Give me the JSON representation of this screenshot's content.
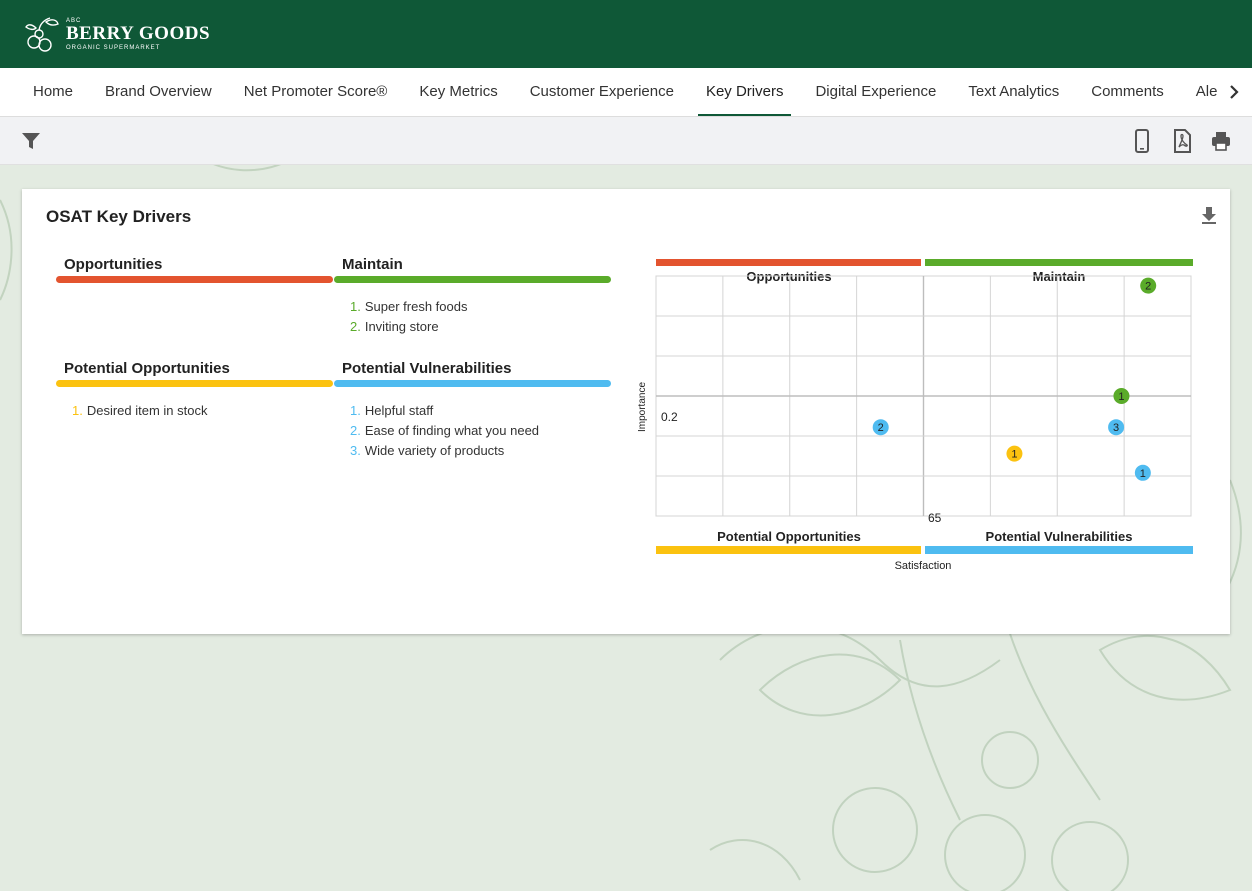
{
  "brand": {
    "abc": "ABC",
    "name": "BERRY GOODS",
    "subtitle": "ORGANIC SUPERMARKET"
  },
  "nav": {
    "tabs": [
      {
        "label": "Home",
        "active": false
      },
      {
        "label": "Brand Overview",
        "active": false
      },
      {
        "label": "Net Promoter Score®",
        "active": false
      },
      {
        "label": "Key Metrics",
        "active": false
      },
      {
        "label": "Customer Experience",
        "active": false
      },
      {
        "label": "Key Drivers",
        "active": true
      },
      {
        "label": "Digital Experience",
        "active": false
      },
      {
        "label": "Text Analytics",
        "active": false
      },
      {
        "label": "Comments",
        "active": false
      },
      {
        "label": "Alerts",
        "active": false
      }
    ],
    "scroll_icon": "chevron-right-icon"
  },
  "toolbar": {
    "left_icons": [
      "filter-icon"
    ],
    "right_icons": [
      "mobile-icon",
      "pdf-icon",
      "print-icon"
    ]
  },
  "card": {
    "title": "OSAT Key Drivers",
    "download_icon": "download-icon"
  },
  "colors": {
    "opportunities": "#e3542f",
    "maintain": "#5aab2a",
    "potential_opportunities": "#fbc210",
    "potential_vulnerabilities": "#4fbbf0",
    "header_green": "#0f5837"
  },
  "quadrants": {
    "opportunities": {
      "title": "Opportunities",
      "items": []
    },
    "maintain": {
      "title": "Maintain",
      "items": [
        "Super fresh foods",
        "Inviting store"
      ]
    },
    "potential_opportunities": {
      "title": "Potential Opportunities",
      "items": [
        "Desired item in stock"
      ]
    },
    "potential_vulnerabilities": {
      "title": "Potential Vulnerabilities",
      "items": [
        "Helpful staff",
        "Ease of finding what you need",
        "Wide variety of products"
      ]
    }
  },
  "chart_data": {
    "type": "scatter",
    "title": "",
    "xlabel": "Satisfaction",
    "ylabel": "Importance",
    "x_mid_label": "65",
    "y_mid_label": "0.2",
    "quadrant_labels": {
      "top_left": "Opportunities",
      "top_right": "Maintain",
      "bottom_left": "Potential Opportunities",
      "bottom_right": "Potential Vulnerabilities"
    },
    "points": [
      {
        "label": "2",
        "quadrant": "maintain",
        "x": 0.92,
        "y": 0.96
      },
      {
        "label": "1",
        "quadrant": "maintain",
        "x": 0.87,
        "y": 0.5
      },
      {
        "label": "2",
        "quadrant": "potential_vulnerabilities",
        "x": 0.42,
        "y": 0.37
      },
      {
        "label": "3",
        "quadrant": "potential_vulnerabilities",
        "x": 0.86,
        "y": 0.37
      },
      {
        "label": "1",
        "quadrant": "potential_vulnerabilities",
        "x": 0.91,
        "y": 0.18
      },
      {
        "label": "1",
        "quadrant": "potential_opportunities",
        "x": 0.67,
        "y": 0.26
      }
    ]
  }
}
